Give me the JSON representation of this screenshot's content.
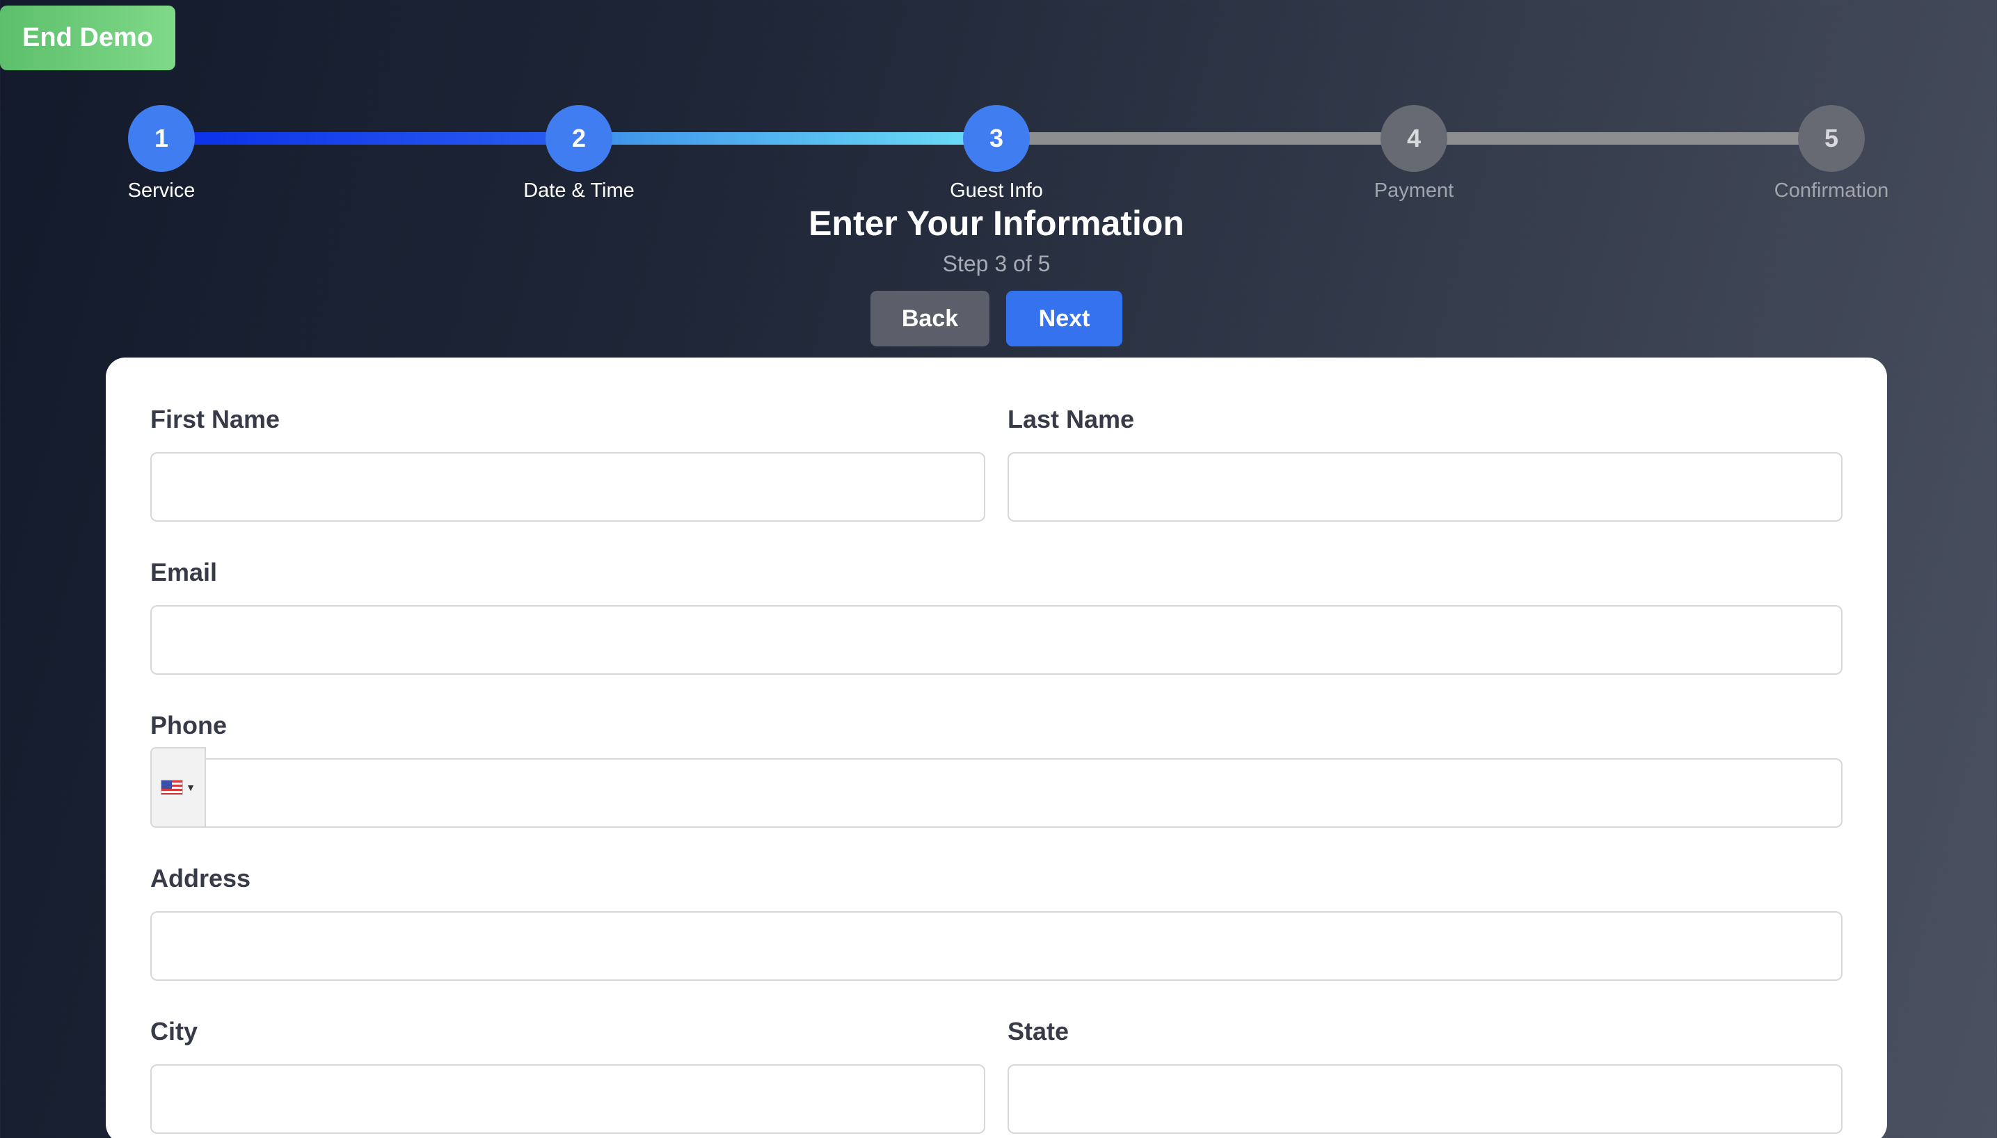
{
  "end_demo_label": "End Demo",
  "stepper": {
    "steps": [
      {
        "number": "1",
        "label": "Service",
        "state": "complete"
      },
      {
        "number": "2",
        "label": "Date & Time",
        "state": "complete"
      },
      {
        "number": "3",
        "label": "Guest Info",
        "state": "current"
      },
      {
        "number": "4",
        "label": "Payment",
        "state": "upcoming"
      },
      {
        "number": "5",
        "label": "Confirmation",
        "state": "upcoming"
      }
    ]
  },
  "header": {
    "title": "Enter Your Information",
    "subtitle": "Step 3 of 5"
  },
  "nav": {
    "back_label": "Back",
    "next_label": "Next"
  },
  "form": {
    "first_name_label": "First Name",
    "first_name_value": "",
    "last_name_label": "Last Name",
    "last_name_value": "",
    "email_label": "Email",
    "email_value": "",
    "phone_label": "Phone",
    "phone_value": "",
    "phone_country_icon": "us-flag-icon",
    "address_label": "Address",
    "address_value": "",
    "city_label": "City",
    "city_value": "",
    "state_label": "State",
    "state_value": ""
  },
  "colors": {
    "active_step": "#3f7df0",
    "inactive_step": "#676a72",
    "next_button": "#3572ee",
    "back_button": "#5b5f6a",
    "end_demo": "#6fcf7c"
  }
}
